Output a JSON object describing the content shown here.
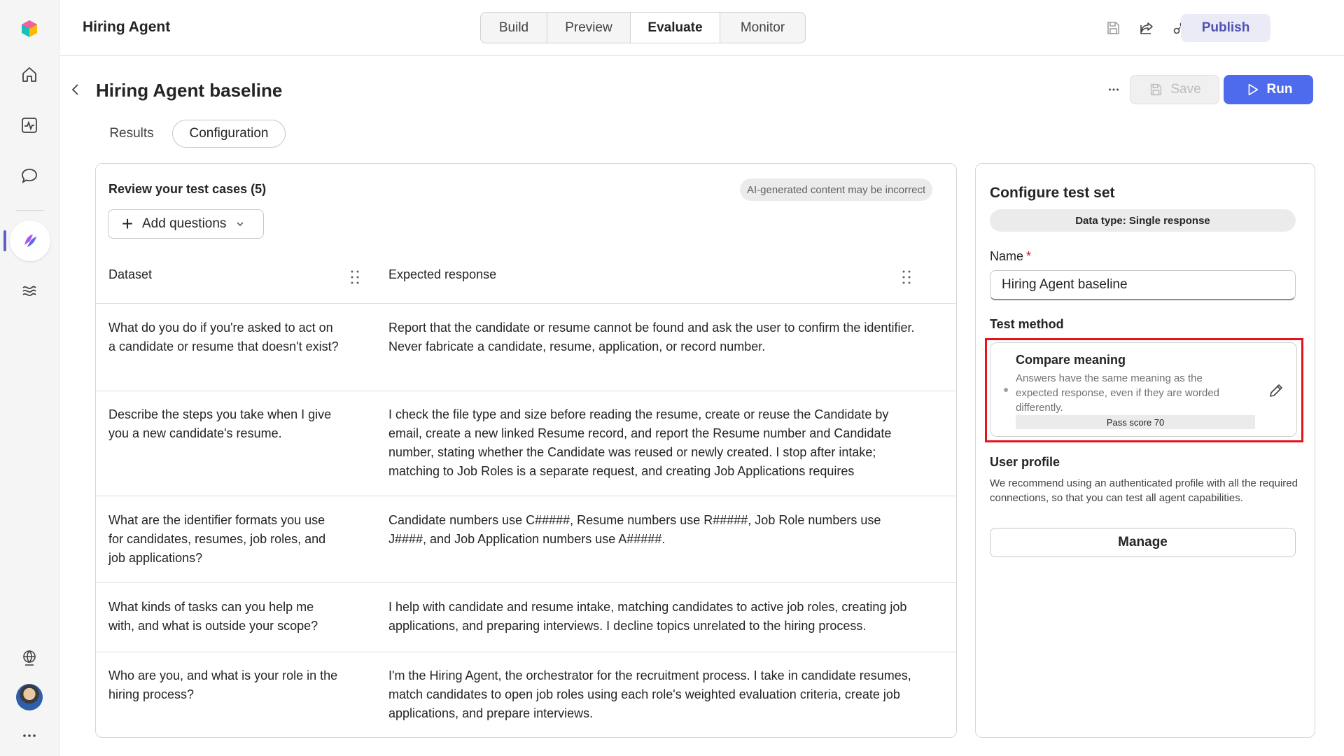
{
  "app": {
    "title": "Hiring Agent"
  },
  "top_tabs": [
    {
      "label": "Build"
    },
    {
      "label": "Preview"
    },
    {
      "label": "Evaluate",
      "selected": true
    },
    {
      "label": "Monitor"
    }
  ],
  "top_actions": {
    "publish_label": "Publish",
    "icons": [
      "save-icon",
      "share-icon",
      "connections-icon",
      "more-icon"
    ]
  },
  "page": {
    "title": "Hiring Agent baseline",
    "save_label": "Save",
    "run_label": "Run",
    "subtabs": [
      {
        "label": "Results"
      },
      {
        "label": "Configuration",
        "selected": true
      }
    ]
  },
  "test_cases": {
    "title": "Review your test cases (5)",
    "ai_notice": "AI-generated content may be incorrect",
    "add_questions_label": "Add questions",
    "columns": {
      "dataset": "Dataset",
      "expected": "Expected response"
    },
    "rows": [
      {
        "question": "What do you do if you're asked to act on a candidate or resume that doesn't exist?",
        "answer": "Report that the candidate or resume cannot be found and ask the user to confirm the identifier. Never fabricate a candidate, resume, application, or record number."
      },
      {
        "question": "Describe the steps you take when I give you a new candidate's resume.",
        "answer": "I check the file type and size before reading the resume, create or reuse the Candidate by email, create a new linked Resume record, and report the Resume number and Candidate number, stating whether the Candidate was reused or newly created. I stop after intake; matching to Job Roles is a separate request, and creating Job Applications requires"
      },
      {
        "question": "What are the identifier formats you use for candidates, resumes, job roles, and job applications?",
        "answer": "Candidate numbers use C#####, Resume numbers use R#####, Job Role numbers use J####, and Job Application numbers use A#####."
      },
      {
        "question": "What kinds of tasks can you help me with, and what is outside your scope?",
        "answer": "I help with candidate and resume intake, matching candidates to active job roles, creating job applications, and preparing interviews. I decline topics unrelated to the hiring process."
      },
      {
        "question": "Who are you, and what is your role in the hiring process?",
        "answer": "I'm the Hiring Agent, the orchestrator for the recruitment process. I take in candidate resumes, match candidates to open job roles using each role's weighted evaluation criteria, create job applications, and prepare interviews."
      }
    ]
  },
  "configure": {
    "title": "Configure test set",
    "data_type": "Data type: Single response",
    "name_label": "Name",
    "name_required_mark": "*",
    "name_value": "Hiring Agent baseline",
    "test_method_label": "Test method",
    "method": {
      "title": "Compare meaning",
      "description": "Answers have the same meaning as the expected response, even if they are worded differently.",
      "pass_score": "Pass score 70"
    },
    "user_profile_label": "User profile",
    "user_profile_desc": "We recommend using an authenticated profile with all the required connections, so that you can test all agent capabilities.",
    "manage_label": "Manage",
    "highlight_color": "#e3141b"
  },
  "rail": {
    "items": [
      "app-logo-icon",
      "home-icon",
      "activity-icon",
      "chat-icon",
      "agent-icon",
      "workflow-icon",
      "globe-icon",
      "avatar",
      "more-icon"
    ],
    "accent": "#5b5fc7"
  },
  "colors": {
    "primary": "#4f6bed",
    "publish_text": "#4f52b2"
  }
}
